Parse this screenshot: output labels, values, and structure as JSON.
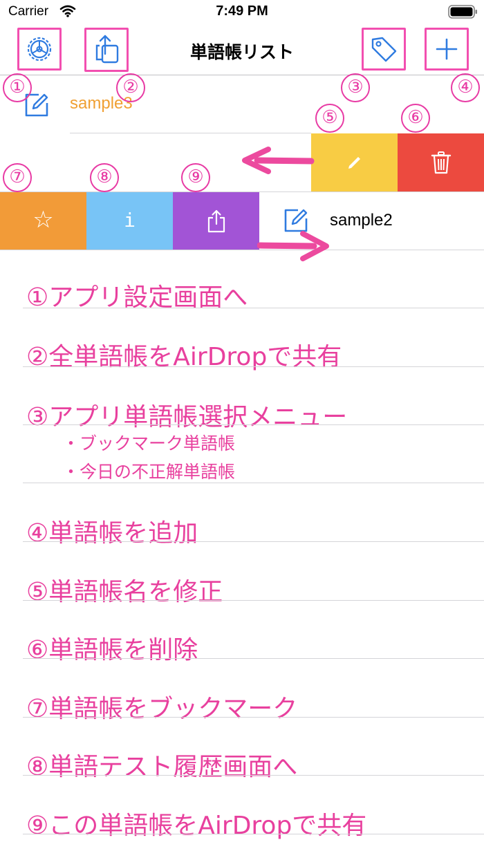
{
  "status_bar": {
    "carrier": "Carrier",
    "time": "7:49 PM"
  },
  "nav": {
    "title": "単語帳リスト",
    "buttons": [
      "settings-gear",
      "share-all",
      "tag-menu",
      "add"
    ]
  },
  "cells": [
    {
      "title": "sample3"
    },
    {
      "title": "sample2"
    }
  ],
  "swipe_trailing_actions": [
    "edit",
    "delete"
  ],
  "swipe_leading_actions": [
    "bookmark",
    "info",
    "share"
  ],
  "action_icons": {
    "info_glyph": "i",
    "bookmark_glyph": "☆"
  },
  "callouts": [
    "①",
    "②",
    "③",
    "④",
    "⑤",
    "⑥",
    "⑦",
    "⑧",
    "⑨"
  ],
  "notes": [
    "①アプリ設定画面へ",
    "②全単語帳をAirDropで共有",
    "③アプリ単語帳選択メニュー",
    "④単語帳を追加",
    "⑤単語帳名を修正",
    "⑥単語帳を削除",
    "⑦単語帳をブックマーク",
    "⑧単語テスト履歴画面へ",
    "⑨この単語帳をAirDropで共有"
  ],
  "sub_notes": [
    "・ブックマーク単語帳",
    "・今日の不正解単語帳"
  ],
  "colors": {
    "tint": "#2f7be0",
    "cell_orange_text": "#f0a033",
    "edit_yellow": "#f8cc44",
    "delete_red": "#ec4a3f",
    "bookmark_orange": "#f29b38",
    "info_blue": "#78c4f6",
    "share_purple": "#a254d6",
    "annotation_pink": "#e8409e"
  }
}
